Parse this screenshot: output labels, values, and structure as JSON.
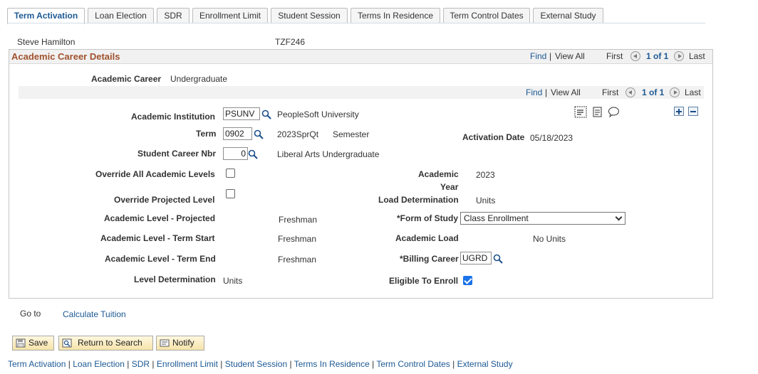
{
  "tabs": [
    {
      "label": "Term Activation",
      "active": true
    },
    {
      "label": "Loan Election"
    },
    {
      "label": "SDR"
    },
    {
      "label": "Enrollment Limit"
    },
    {
      "label": "Student Session"
    },
    {
      "label": "Terms In Residence"
    },
    {
      "label": "Term Control Dates"
    },
    {
      "label": "External Study"
    }
  ],
  "student": {
    "name": "Steve Hamilton",
    "id": "TZF246"
  },
  "section": {
    "title": "Academic Career Details",
    "nav": {
      "find": "Find",
      "sep": "|",
      "view_all": "View All",
      "first": "First",
      "count": "1 of 1",
      "last": "Last"
    }
  },
  "career": {
    "label": "Academic Career",
    "value": "Undergraduate"
  },
  "subnav": {
    "find": "Find",
    "sep": "|",
    "view_all": "View All",
    "first": "First",
    "count": "1 of 1",
    "last": "Last"
  },
  "fields": {
    "institution": {
      "label": "Academic Institution",
      "value": "PSUNV",
      "desc": "PeopleSoft University"
    },
    "term": {
      "label": "Term",
      "value": "0902",
      "desc": "2023SprQt",
      "desc2": "Semester"
    },
    "activation_date": {
      "label": "Activation Date",
      "value": "05/18/2023"
    },
    "career_nbr": {
      "label": "Student Career Nbr",
      "value": "0",
      "desc": "Liberal Arts Undergraduate"
    },
    "override_levels": {
      "label": "Override All Academic Levels",
      "checked": false
    },
    "academic_year": {
      "label_line1": "Academic",
      "label_line2": "Year",
      "value": "2023"
    },
    "override_projected": {
      "label": "Override Projected Level",
      "checked": false
    },
    "load_determination": {
      "label": "Load Determination",
      "value": "Units"
    },
    "level_projected": {
      "label": "Academic Level - Projected",
      "value": "Freshman"
    },
    "form_of_study": {
      "label": "*Form of Study",
      "value": "Class Enrollment"
    },
    "level_term_start": {
      "label": "Academic Level - Term Start",
      "value": "Freshman"
    },
    "academic_load": {
      "label": "Academic Load",
      "value": "No Units"
    },
    "level_term_end": {
      "label": "Academic Level - Term End",
      "value": "Freshman"
    },
    "billing_career": {
      "label": "*Billing Career",
      "value": "UGRD"
    },
    "level_determination": {
      "label": "Level Determination",
      "value": "Units"
    },
    "eligible_to_enroll": {
      "label": "Eligible To Enroll",
      "checked": true
    }
  },
  "goto": {
    "label": "Go to",
    "link": "Calculate Tuition"
  },
  "buttons": {
    "save": "Save",
    "return": "Return to Search",
    "notify": "Notify"
  },
  "bottom_links": [
    "Term Activation",
    "Loan Election",
    "SDR",
    "Enrollment Limit",
    "Student Session",
    "Terms In Residence",
    "Term Control Dates",
    "External Study"
  ],
  "bottom_sep": "|",
  "colors": {
    "accent": "#1c5994",
    "section_title": "#a0522d",
    "button_bg": "#f6e3a9",
    "checkbox": "#1a73e8"
  }
}
